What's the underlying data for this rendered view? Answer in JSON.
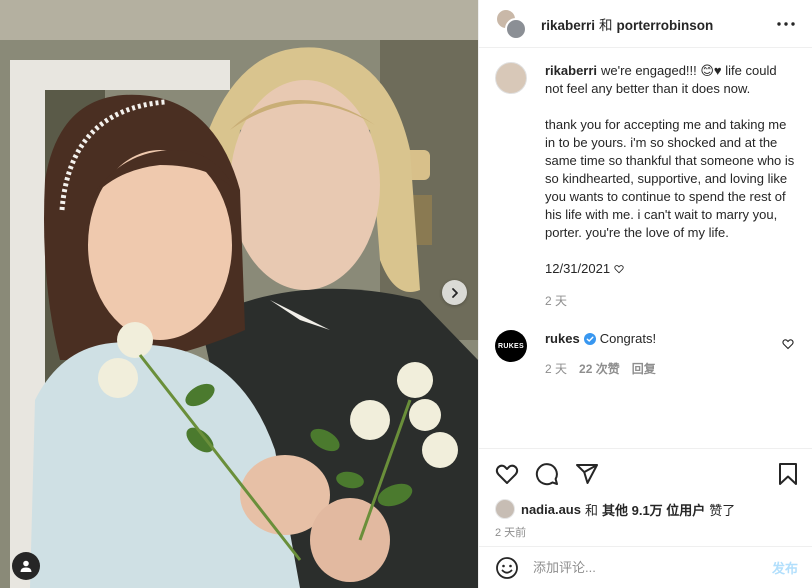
{
  "header": {
    "user1": "rikaberri",
    "joiner": "和",
    "user2": "porterrobinson"
  },
  "caption": {
    "username": "rikaberri",
    "first_text": "we're engaged!!! 😊♥ life could not feel any better than it does now.",
    "paragraph2": "thank you for accepting me and taking me in to be yours. i'm so shocked and at the same time so thankful that someone who is so kindhearted, supportive, and loving like you wants to continue to spend the rest of his life with me. i can't wait to marry you, porter. you're the love of my life.",
    "date": "12/31/2021",
    "age": "2 天"
  },
  "comment": {
    "username": "rukes",
    "avatar_text": "RUKES",
    "text": "Congrats!",
    "age": "2 天",
    "likes": "22 次赞",
    "reply": "回复"
  },
  "likes": {
    "user": "nadia.aus",
    "and": "和",
    "others": "其他 9.1万 位用户",
    "suffix": "赞了"
  },
  "time_ago": "2 天前",
  "add_comment": {
    "placeholder": "添加评论...",
    "post_label": "发布"
  },
  "colors": {
    "verified": "#3897f0",
    "post_button_disabled": "#b2dffc",
    "meta_gray": "#8e8e8e"
  }
}
